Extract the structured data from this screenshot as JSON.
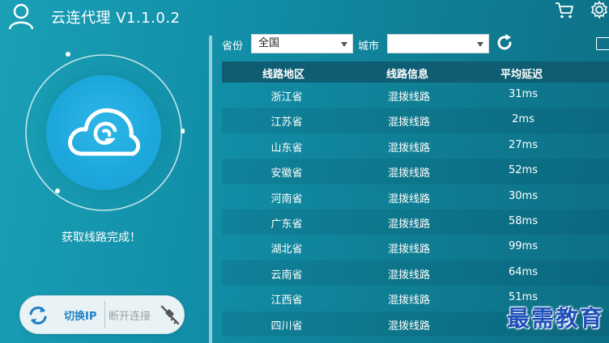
{
  "header": {
    "app_title": "云连代理 V1.1.0.2",
    "icons": [
      "user-icon",
      "cart-icon",
      "gear-icon"
    ]
  },
  "left_panel": {
    "status_text": "获取线路完成！",
    "switch_label": "切换IP",
    "disconnect_label": "断开连接",
    "colors": {
      "accent": "#1ca7dc",
      "switch_text": "#1f7fc4",
      "disabled_text": "#9aa3a6"
    }
  },
  "filters": {
    "province_label": "省份",
    "province_value": "全国",
    "city_label": "城市",
    "city_value": ""
  },
  "table": {
    "headers": [
      "线路地区",
      "线路信息",
      "平均延迟"
    ],
    "rows": [
      {
        "region": "浙江省",
        "info": "混拨线路",
        "latency": "31ms"
      },
      {
        "region": "江苏省",
        "info": "混拨线路",
        "latency": "2ms"
      },
      {
        "region": "山东省",
        "info": "混拨线路",
        "latency": "27ms"
      },
      {
        "region": "安徽省",
        "info": "混拨线路",
        "latency": "52ms"
      },
      {
        "region": "河南省",
        "info": "混拨线路",
        "latency": "30ms"
      },
      {
        "region": "广东省",
        "info": "混拨线路",
        "latency": "58ms"
      },
      {
        "region": "湖北省",
        "info": "混拨线路",
        "latency": "99ms"
      },
      {
        "region": "云南省",
        "info": "混拨线路",
        "latency": "64ms"
      },
      {
        "region": "江西省",
        "info": "混拨线路",
        "latency": "51ms"
      },
      {
        "region": "四川省",
        "info": "混拨线路",
        "latency": ""
      }
    ]
  },
  "watermark": "最需教育"
}
